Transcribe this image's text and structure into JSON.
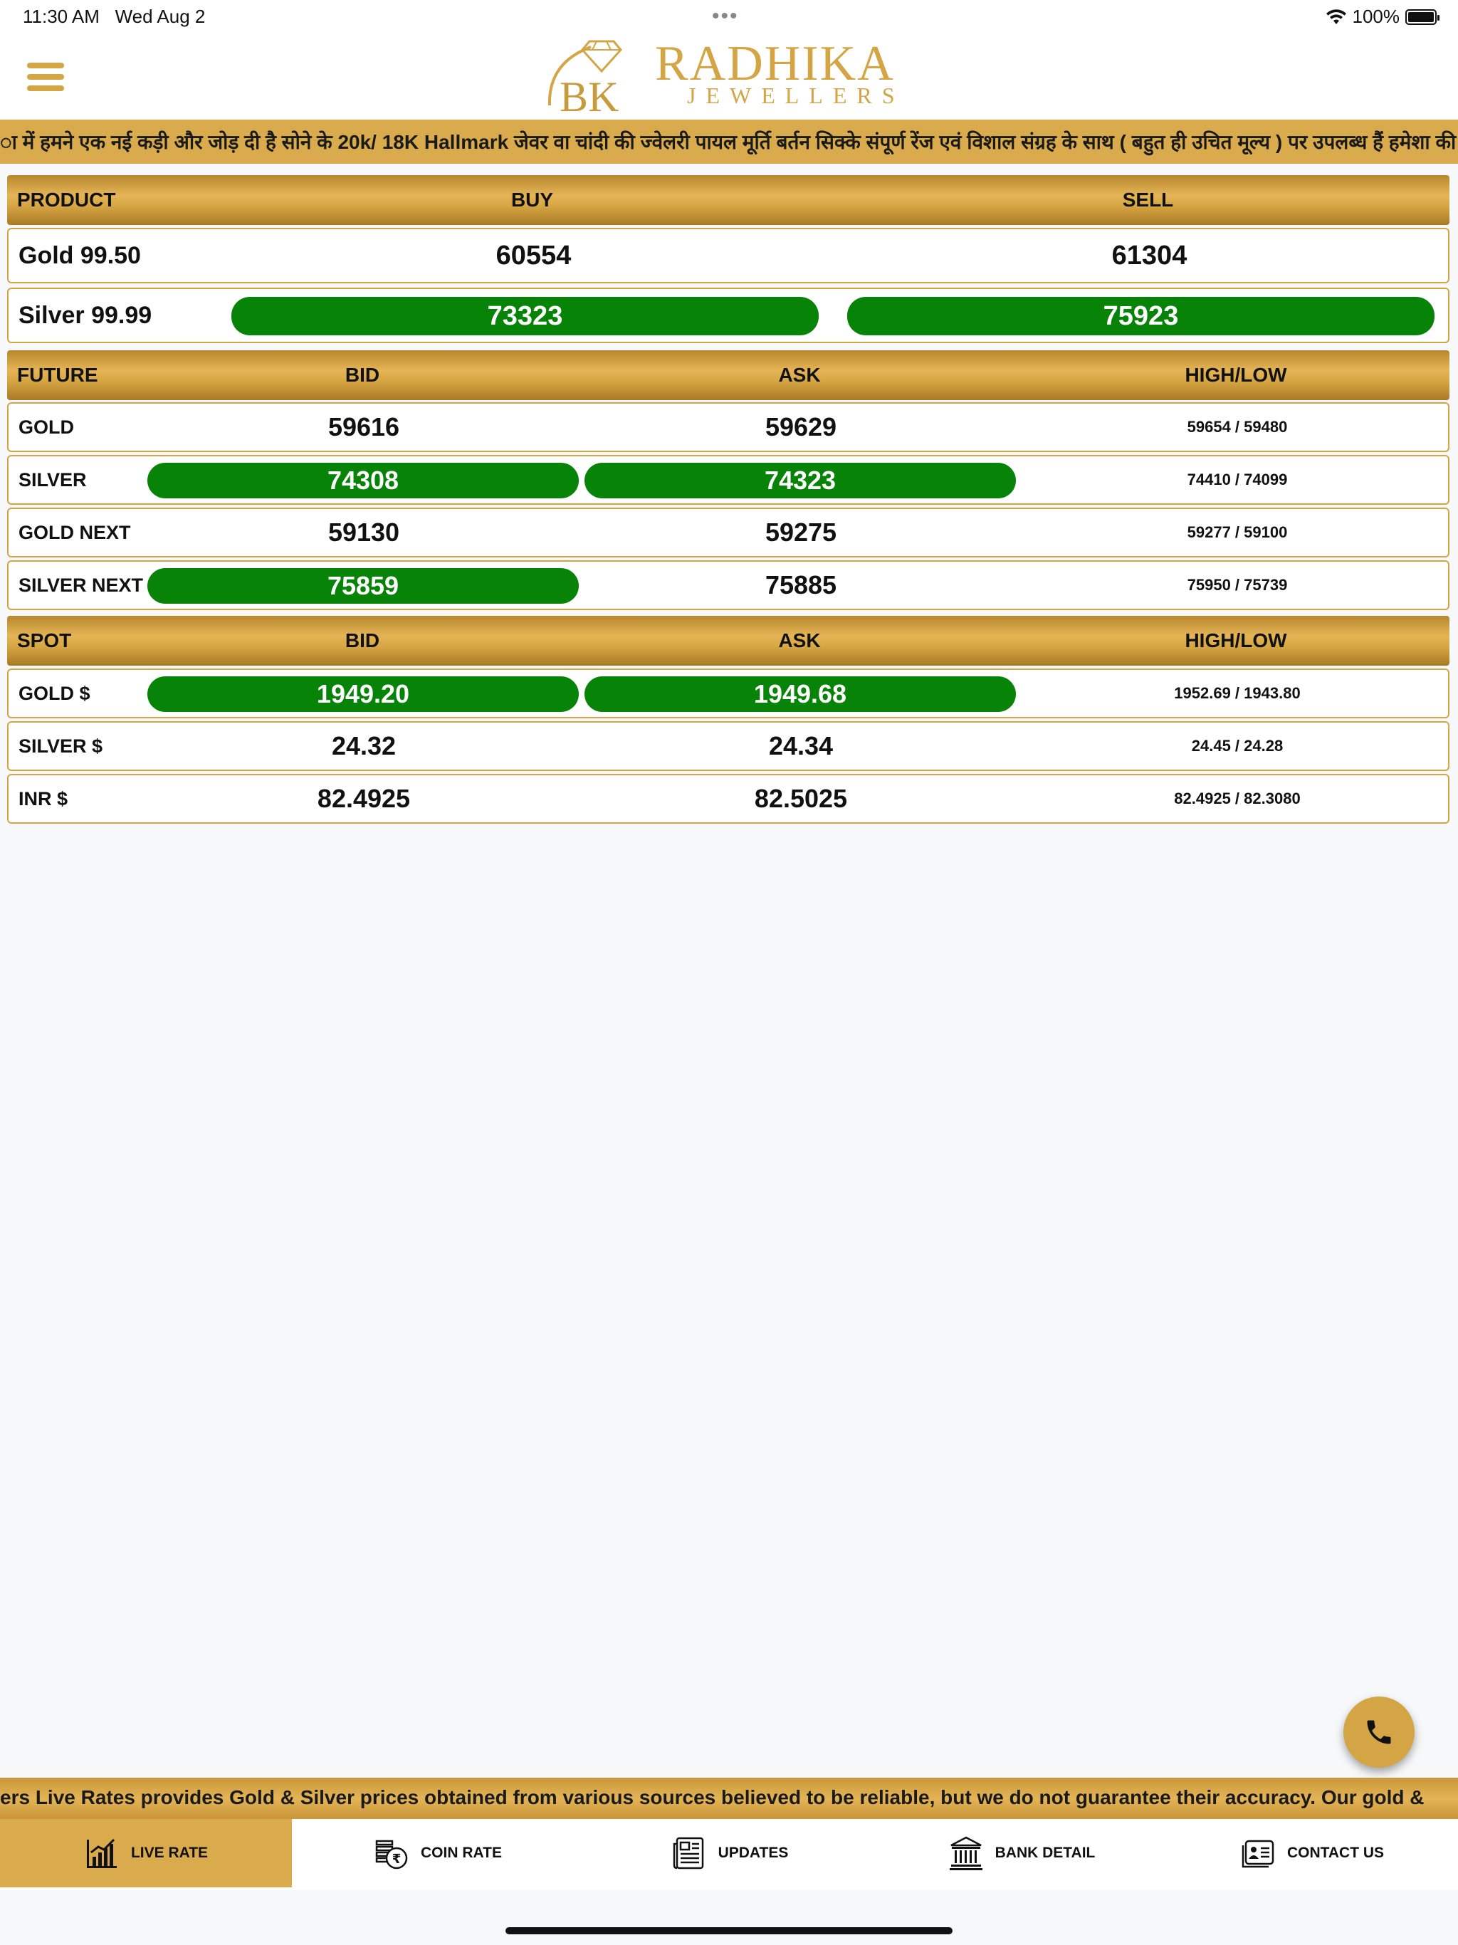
{
  "status_bar": {
    "time": "11:30 AM",
    "date": "Wed Aug 2",
    "battery": "100%"
  },
  "brand": {
    "title": "RADHIKA",
    "subtitle": "JEWELLERS",
    "monogram": "BK"
  },
  "ticker": "ा में हमने एक नई कड़ी और जोड़ दी है सोने के 20k/ 18K Hallmark जेवर वा चांदी की ज्वेलरी पायल मूर्ति बर्तन सिक्के संपूर्ण रेंज एवं विशाल संग्रह के साथ ( बहुत ही उचित मूल्य ) पर उपलब्ध हैं हमेशा की",
  "product_table": {
    "headers": {
      "product": "PRODUCT",
      "buy": "BUY",
      "sell": "SELL"
    },
    "rows": [
      {
        "name": "Gold 99.50",
        "buy": "60554",
        "sell": "61304"
      },
      {
        "name": "Silver 99.99",
        "buy": "73323",
        "sell": "75923"
      }
    ]
  },
  "future_table": {
    "headers": {
      "name": "FUTURE",
      "bid": "BID",
      "ask": "ASK",
      "highlow": "HIGH/LOW"
    },
    "rows": [
      {
        "name": "GOLD",
        "bid": "59616",
        "ask": "59629",
        "highlow": "59654 / 59480"
      },
      {
        "name": "SILVER",
        "bid": "74308",
        "ask": "74323",
        "highlow": "74410 / 74099"
      },
      {
        "name": "GOLD NEXT",
        "bid": "59130",
        "ask": "59275",
        "highlow": "59277 / 59100"
      },
      {
        "name": "SILVER NEXT",
        "bid": "75859",
        "ask": "75885",
        "highlow": "75950 / 75739"
      }
    ]
  },
  "spot_table": {
    "headers": {
      "name": "SPOT",
      "bid": "BID",
      "ask": "ASK",
      "highlow": "HIGH/LOW"
    },
    "rows": [
      {
        "name": "GOLD $",
        "bid": "1949.20",
        "ask": "1949.68",
        "highlow": "1952.69 / 1943.80"
      },
      {
        "name": "SILVER $",
        "bid": "24.32",
        "ask": "24.34",
        "highlow": "24.45 / 24.28"
      },
      {
        "name": "INR $",
        "bid": "82.4925",
        "ask": "82.5025",
        "highlow": "82.4925 / 82.3080"
      }
    ]
  },
  "disclaimer": "ers Live Rates provides Gold & Silver prices obtained from various sources believed to be reliable, but we do not guarantee their accuracy. Our gold &",
  "nav": [
    {
      "label": "LIVE RATE",
      "icon": "chart-icon"
    },
    {
      "label": "COIN RATE",
      "icon": "coin-icon"
    },
    {
      "label": "UPDATES",
      "icon": "newspaper-icon"
    },
    {
      "label": "BANK DETAIL",
      "icon": "bank-icon"
    },
    {
      "label": "CONTACT US",
      "icon": "contact-card-icon"
    }
  ],
  "colors": {
    "gold": "#d4a545",
    "green": "#078407",
    "active_nav": "#d9ab4d"
  }
}
